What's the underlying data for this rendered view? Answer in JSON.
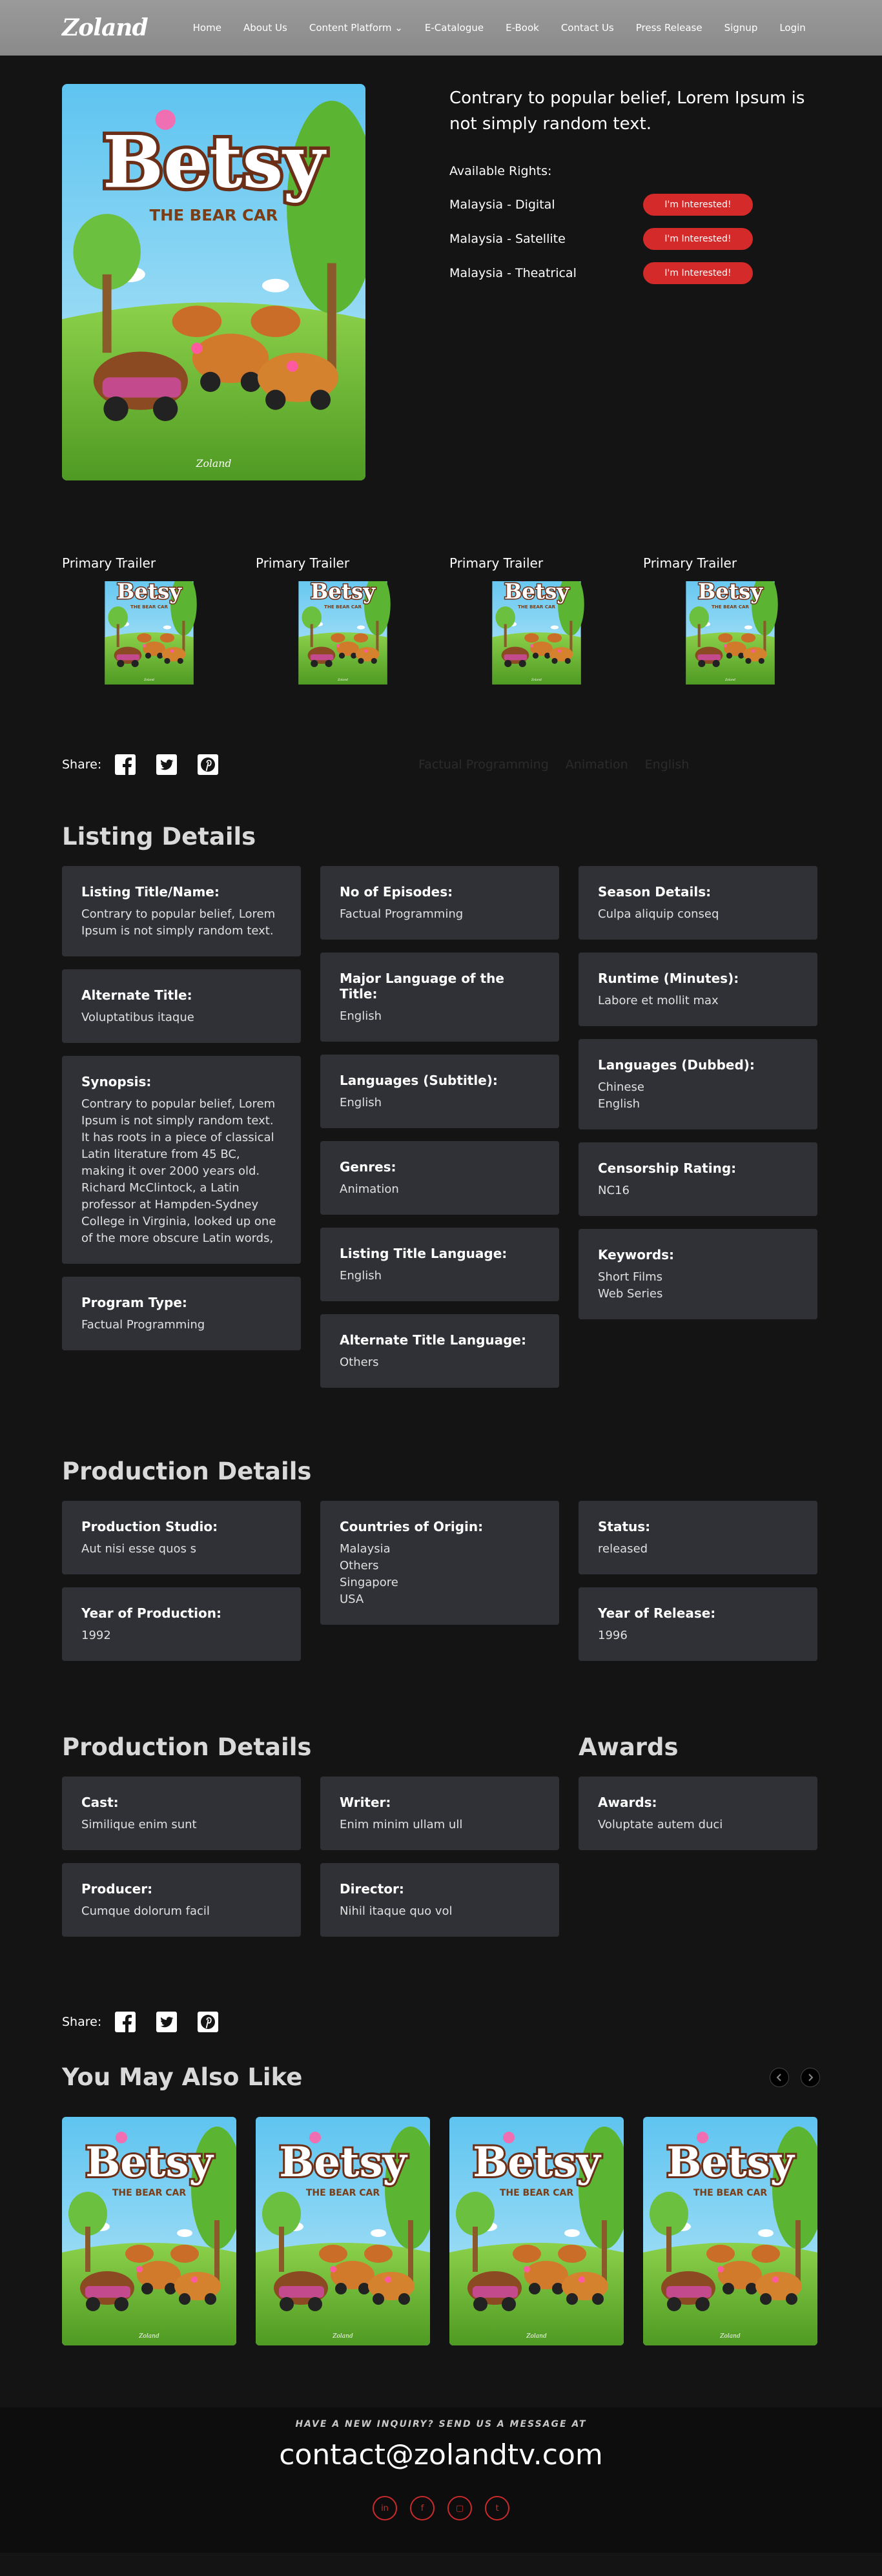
{
  "nav": {
    "logo": "Zoland",
    "items": [
      "Home",
      "About Us",
      "Content Platform ⌄",
      "E-Catalogue",
      "E-Book",
      "Contact Us",
      "Press Release",
      "Signup",
      "Login"
    ]
  },
  "poster": {
    "brand": "Betsy",
    "subtitle": "THE BEAR CAR",
    "watermark": "Zoland"
  },
  "hero": {
    "title": "Contrary to popular belief, Lorem Ipsum is not simply random text.",
    "rights_heading": "Available Rights:",
    "button_label": "I'm Interested!",
    "rights": [
      "Malaysia - Digital",
      "Malaysia - Satellite",
      "Malaysia - Theatrical"
    ]
  },
  "trailers": [
    "Primary Trailer",
    "Primary Trailer",
    "Primary Trailer",
    "Primary Trailer"
  ],
  "share": {
    "label": "Share:",
    "icons": [
      "facebook-icon",
      "twitter-icon",
      "pinterest-icon"
    ],
    "tags": [
      "Factual Programming",
      "Animation",
      "English"
    ]
  },
  "listing": {
    "title": "Listing Details",
    "col1": [
      {
        "label": "Listing Title/Name:",
        "value": "Contrary to popular belief, Lorem Ipsum is not simply random text."
      },
      {
        "label": "Alternate Title:",
        "value": "Voluptatibus itaque"
      },
      {
        "label": "Synopsis:",
        "value": "Contrary to popular belief, Lorem Ipsum is not simply random text. It has roots in a piece of classical Latin literature from 45 BC, making it over 2000 years old. Richard McClintock, a Latin professor at Hampden-Sydney College in Virginia, looked up one of the more obscure Latin words,"
      },
      {
        "label": "Program Type:",
        "value": "Factual Programming"
      }
    ],
    "col2": [
      {
        "label": "No of Episodes:",
        "value": "Factual Programming"
      },
      {
        "label": "Major Language of the Title:",
        "value": "English"
      },
      {
        "label": "Languages (Subtitle):",
        "value": "English"
      },
      {
        "label": "Genres:",
        "value": "Animation"
      },
      {
        "label": "Listing Title Language:",
        "value": "English"
      },
      {
        "label": "Alternate Title Language:",
        "value": "Others"
      }
    ],
    "col3": [
      {
        "label": "Season Details:",
        "value": "Culpa aliquip conseq"
      },
      {
        "label": "Runtime (Minutes):",
        "value": "Labore et mollit max"
      },
      {
        "label": "Languages (Dubbed):",
        "value": "Chinese\nEnglish"
      },
      {
        "label": "Censorship Rating:",
        "value": "NC16"
      },
      {
        "label": "Keywords:",
        "value": "Short Films\nWeb Series"
      }
    ]
  },
  "production": {
    "title": "Production Details",
    "col1": [
      {
        "label": "Production Studio:",
        "value": "Aut nisi esse quos s"
      },
      {
        "label": "Year of Production:",
        "value": "1992"
      }
    ],
    "col2": [
      {
        "label": "Countries of Origin:",
        "value": "Malaysia\nOthers\nSingapore\nUSA"
      }
    ],
    "col3": [
      {
        "label": "Status:",
        "value": "released"
      },
      {
        "label": "Year of Release:",
        "value": "1996"
      }
    ]
  },
  "crew": {
    "title": "Production Details",
    "col1": [
      {
        "label": "Cast:",
        "value": "Similique enim sunt"
      },
      {
        "label": "Producer:",
        "value": "Cumque dolorum facil"
      }
    ],
    "col2": [
      {
        "label": "Writer:",
        "value": "Enim minim ullam ull"
      },
      {
        "label": "Director:",
        "value": "Nihil itaque quo vol"
      }
    ]
  },
  "awards": {
    "title": "Awards",
    "items": [
      {
        "label": "Awards:",
        "value": "Voluptate autem duci"
      }
    ]
  },
  "related": {
    "title": "You May Also Like",
    "count": 4
  },
  "footer": {
    "small": "HAVE A NEW INQUIRY? SEND US A MESSAGE AT",
    "email": "contact@zolandtv.com",
    "socials": [
      "in",
      "f",
      "▢",
      "t"
    ]
  },
  "colors": {
    "accent": "#d42a2a",
    "card": "#303136",
    "background": "#141414"
  }
}
